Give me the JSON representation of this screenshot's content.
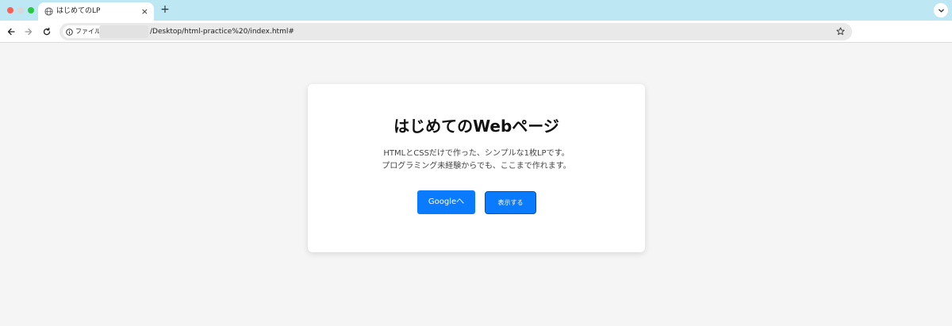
{
  "browser": {
    "tab": {
      "title": "はじめてのLP",
      "close_glyph": "×",
      "favicon": "globe-icon"
    },
    "new_tab_glyph": "+",
    "tab_menu_icon": "chevron-down-icon",
    "toolbar": {
      "back_icon": "arrow-left-icon",
      "forward_icon": "arrow-right-icon",
      "reload_icon": "reload-icon",
      "site_chip_label": "ファイル",
      "site_chip_icon": "info-icon",
      "url": "/Desktop/html-practice%20/index.html#",
      "bookmark_icon": "star-icon"
    },
    "traffic_lights": {
      "close": "#fd5f57",
      "minimize": "#d8d8d8",
      "zoom": "#28c840"
    },
    "tabstrip_color": "#bde7f3"
  },
  "page": {
    "background": "#f5f5f5",
    "card": {
      "title": "はじめてのWebページ",
      "description_line1": "HTMLとCSSだけで作った、シンプルな1枚LPです。",
      "description_line2": "プログラミング未経験からでも、ここまで作れます。",
      "primary_button_label": "Googleへ",
      "secondary_button_label": "表示する",
      "accent_color": "#0a7bff"
    }
  }
}
